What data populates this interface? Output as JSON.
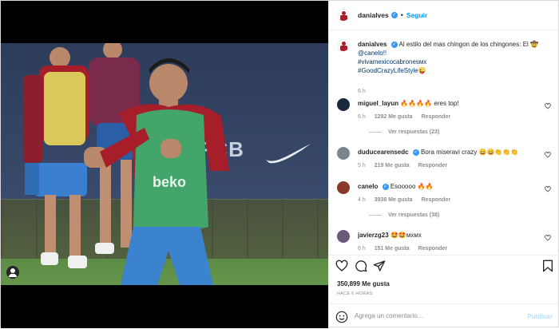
{
  "post": {
    "username": "danialves",
    "follow_label": "Seguir",
    "caption_user": "danialves",
    "caption_text": "Al estilo del mas chingon de los chingones: El 🤠",
    "caption_mention": "@canelo!!",
    "caption_tag1": "#vivamexicocabronesмx",
    "caption_tag2": "#GoodCrazyLifeStyle😜",
    "caption_time": "6 h",
    "banner_text": "/ FCB",
    "bib_text": "beko"
  },
  "comments": [
    {
      "user": "miguel_layun",
      "text": "🔥🔥🔥🔥 eres top!",
      "time": "6 h",
      "likes": "1282 Me gusta",
      "reply": "Responder",
      "replies": "Ver respuestas (23)"
    },
    {
      "user": "duducearensedc",
      "text": "Bora miseravi crazy 😄😄👏👏👏",
      "time": "5 h",
      "likes": "219 Me gusta",
      "reply": "Responder",
      "replies": ""
    },
    {
      "user": "canelo",
      "text": "Esooooo 🔥🔥",
      "time": "4 h",
      "likes": "3938 Me gusta",
      "reply": "Responder",
      "replies": "Ver respuestas (38)"
    },
    {
      "user": "javierzg23",
      "text": "🤩🤩мхмх",
      "time": "6 h",
      "likes": "151 Me gusta",
      "reply": "Responder",
      "replies": ""
    }
  ],
  "actions": {
    "likes": "350,899 Me gusta",
    "time_ago": "HACE 6 HORAS",
    "comment_placeholder": "Agrega un comentario...",
    "publish_label": "Publicar"
  },
  "icons": {
    "like": "heart-icon",
    "comment": "comment-icon",
    "share": "share-icon",
    "save": "bookmark-icon",
    "emoji": "smiley-icon",
    "verified": "verified-badge-icon"
  },
  "colors": {
    "link": "#00376b",
    "follow": "#0095f6",
    "verified": "#3897f0",
    "muted": "#8e8e8e"
  }
}
